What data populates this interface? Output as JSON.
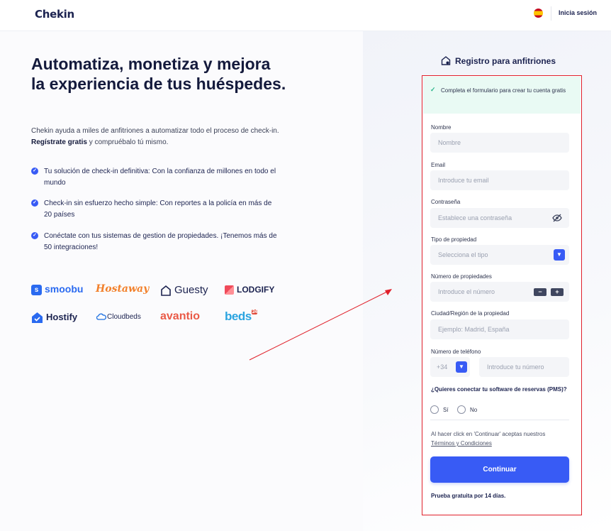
{
  "header": {
    "logo": "Chekin",
    "login": "Inicia sesión"
  },
  "hero": {
    "title": "Automatiza, monetiza y mejora la experiencia de tus huéspedes.",
    "desc_prefix": "Chekin ayuda a miles de anfitriones a automatizar todo el proceso de check-in. ",
    "desc_bold": "Regístrate gratis",
    "desc_suffix": " y compruébalo tú mismo."
  },
  "benefits": [
    "Tu solución de check-in definitiva: Con la confianza de millones en todo el mundo",
    "Check-in sin esfuerzo hecho simple: Con reportes a la policía en más de 20 países",
    "Conéctate con tus sistemas de gestion de propiedades. ¡Tenemos más de 50 integraciones!"
  ],
  "brands": {
    "smoobu": "smoobu",
    "hostaway": "Hostaway",
    "guesty": "Guesty",
    "lodgify": "LODGIFY",
    "hostify": "Hostify",
    "cloudbeds": "Cloudbeds",
    "avantio": "avantio",
    "beds": "beds",
    "beds_badge": "24"
  },
  "form": {
    "title": "Registro para anfitriones",
    "notice": "Completa el formulario para crear tu cuenta gratis",
    "name_label": "Nombre",
    "name_placeholder": "Nombre",
    "email_label": "Email",
    "email_placeholder": "Introduce tu email",
    "password_label": "Contraseña",
    "password_placeholder": "Establece una contraseña",
    "property_type_label": "Tipo de propiedad",
    "property_type_placeholder": "Selecciona el tipo",
    "properties_count_label": "Número de propiedades",
    "properties_count_placeholder": "Introduce el número",
    "city_label": "Ciudad/Región de la propiedad",
    "city_placeholder": "Ejemplo: Madrid, España",
    "phone_label": "Número de teléfono",
    "phone_prefix": "+34",
    "phone_placeholder": "Introduce tu número",
    "pms_question": "¿Quieres conectar tu software de reservas (PMS)?",
    "pms_yes": "Sí",
    "pms_no": "No",
    "terms_text": "Al hacer click en 'Continuar' aceptas nuestros",
    "terms_link": "Términos y Condiciones",
    "submit": "Continuar",
    "trial": "Prueba gratuita por 14 días."
  },
  "colors": {
    "accent": "#385bf5",
    "annotation": "#e0202a",
    "notice_bg": "#e9faf4"
  }
}
